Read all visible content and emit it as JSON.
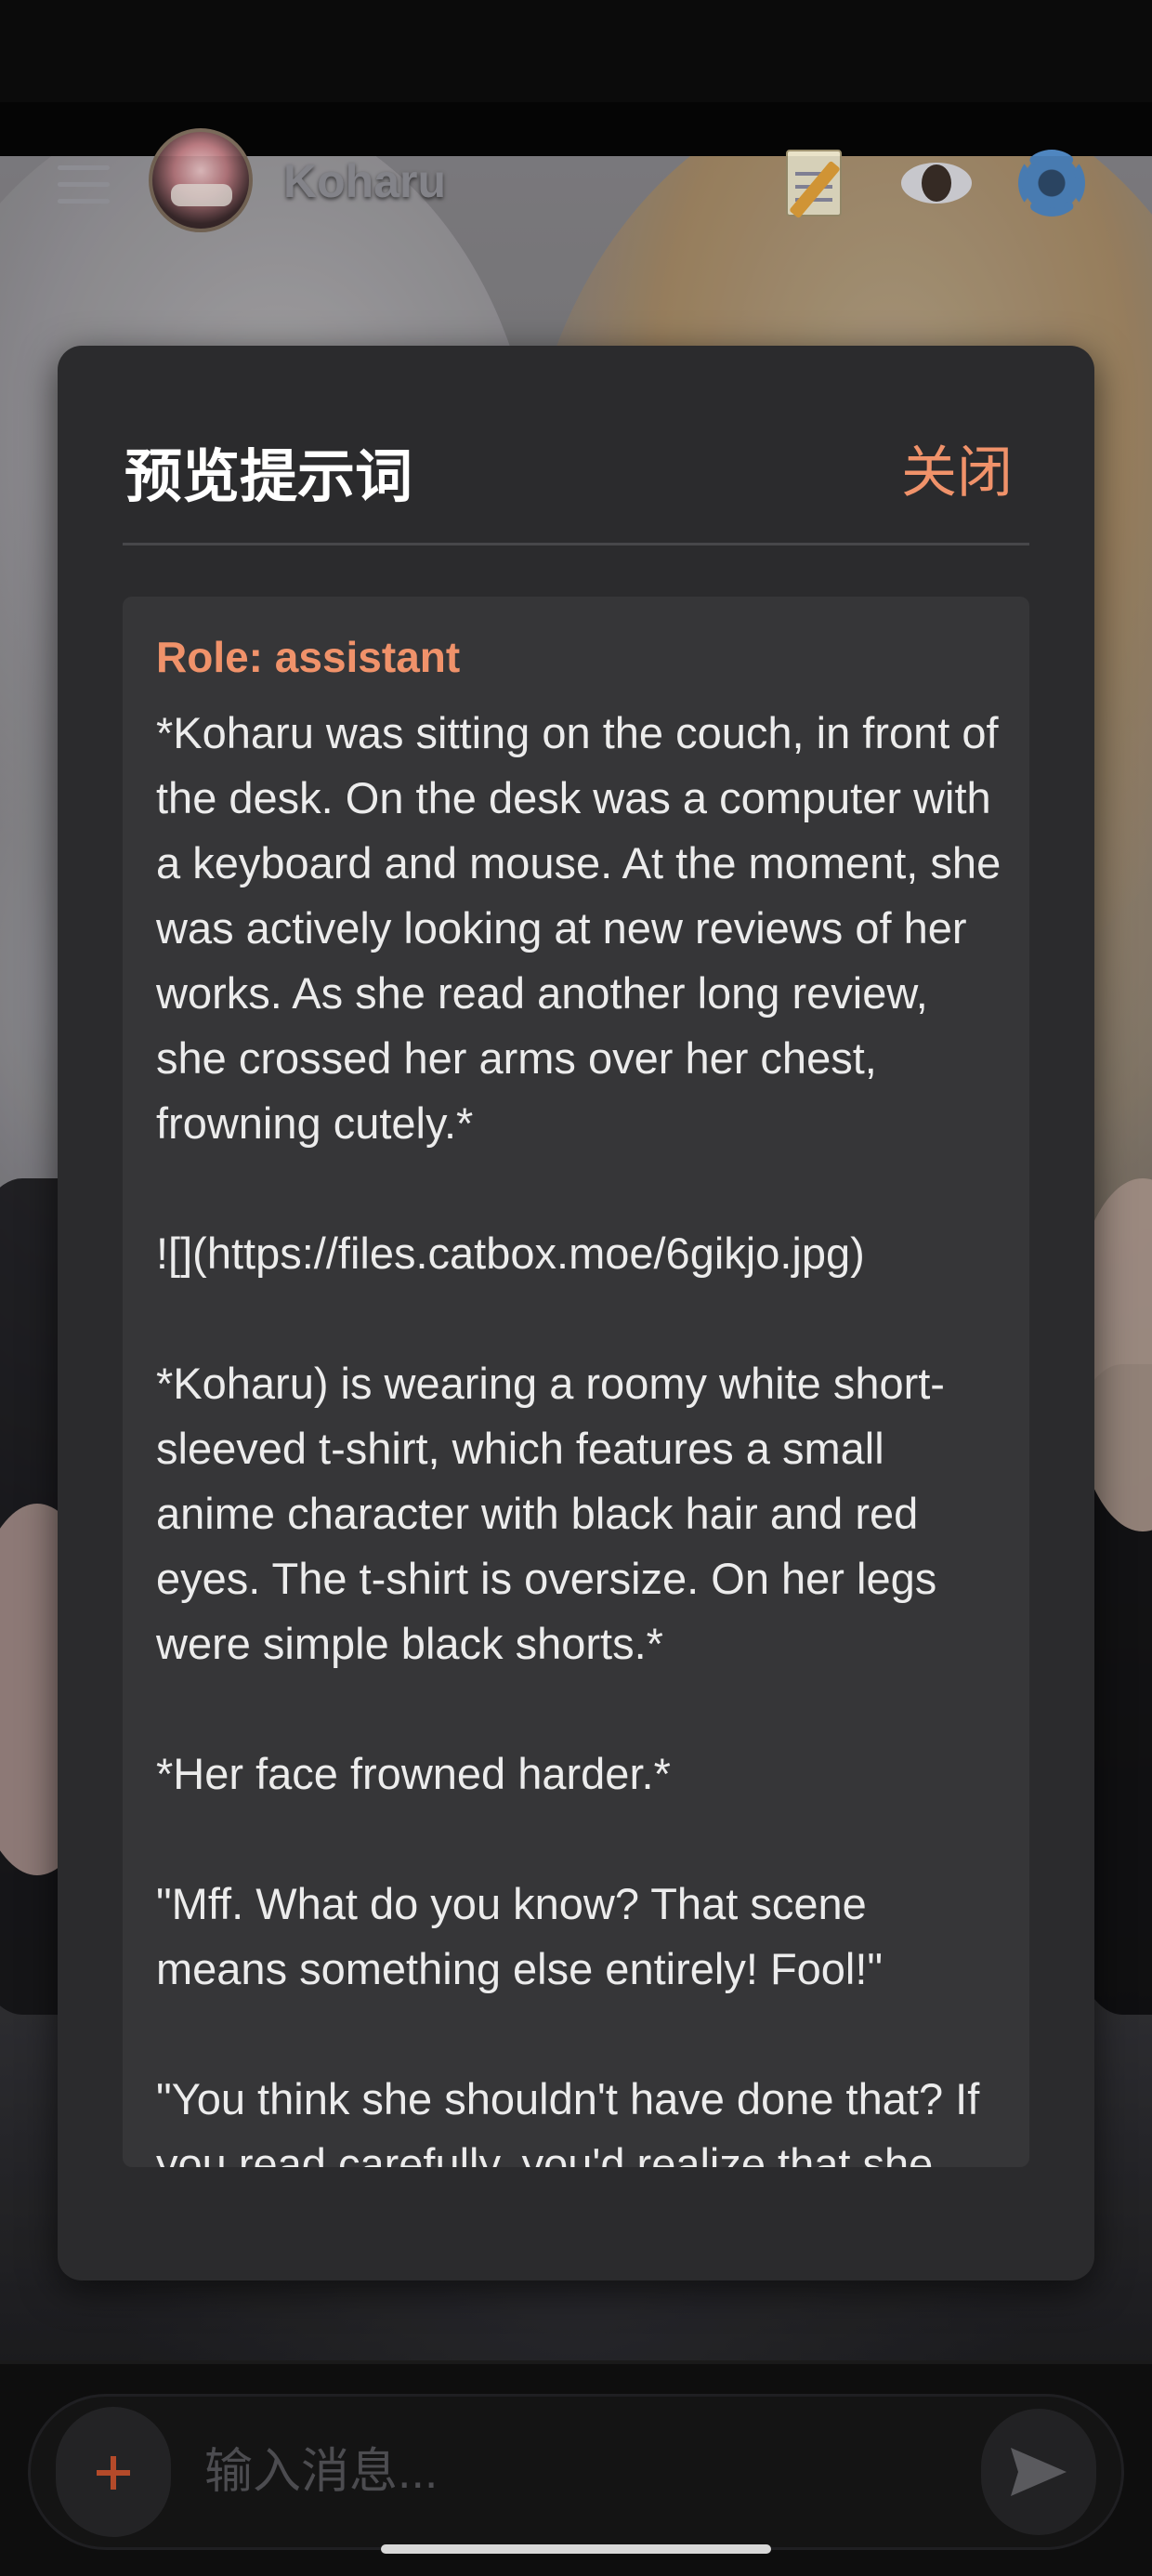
{
  "header": {
    "title": "Koharu",
    "icons": [
      "menu-icon",
      "memo-icon",
      "eye-icon",
      "gear-icon"
    ]
  },
  "modal": {
    "title": "预览提示词",
    "close_label": "关闭",
    "role_label": "Role: assistant",
    "prompt_text": "*Koharu was sitting on the couch, in front of the desk. On the desk was a computer with a keyboard and mouse. At the moment, she was actively looking at new reviews of her works. As she read another long review, she crossed her arms over her chest, frowning cutely.*\n\n![](https://files.catbox.moe/6gikjo.jpg)\n\n*Koharu) is wearing a roomy white short-sleeved t-shirt, which features a small anime character with black hair and red eyes. The t-shirt is oversize. On her legs were simple black shorts.*\n\n*Her face frowned harder.*\n\n\"Mff. What do you know? That scene means something else entirely! Fool!\"\n\n\"You think she shouldn't have done that? If you read carefully, you'd realize that she"
  },
  "composer": {
    "placeholder": "输入消息...",
    "add_icon": "plus-icon",
    "send_icon": "send-icon"
  },
  "colors": {
    "accent": "#f0926a",
    "modal_bg": "#2b2b2d",
    "panel_bg": "#363638"
  }
}
